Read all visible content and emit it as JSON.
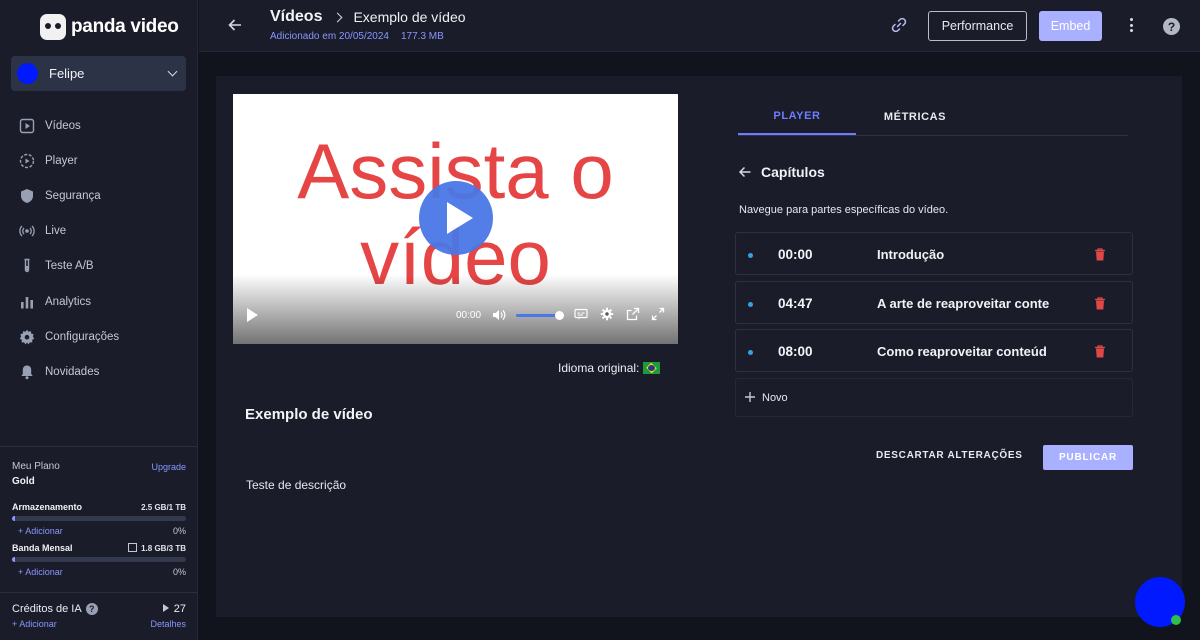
{
  "brand": {
    "name": "panda video"
  },
  "account": {
    "name": "Felipe",
    "avatar_color": "#0019ff"
  },
  "sidebar": {
    "items": [
      {
        "label": "Vídeos",
        "icon": "video-icon"
      },
      {
        "label": "Player",
        "icon": "player-icon"
      },
      {
        "label": "Segurança",
        "icon": "shield-icon"
      },
      {
        "label": "Live",
        "icon": "broadcast-icon"
      },
      {
        "label": "Teste A/B",
        "icon": "test-tube-icon"
      },
      {
        "label": "Analytics",
        "icon": "bar-chart-icon"
      },
      {
        "label": "Configurações",
        "icon": "gear-icon"
      },
      {
        "label": "Novidades",
        "icon": "bell-icon"
      }
    ]
  },
  "plan": {
    "label": "Meu Plano",
    "name": "Gold",
    "upgrade": "Upgrade",
    "storage": {
      "label": "Armazenamento",
      "value": "2.5 GB/1 TB",
      "add": "+ Adicionar",
      "percent": "0%",
      "fill": 0.0025
    },
    "bandwidth": {
      "label": "Banda Mensal",
      "value": "1.8 GB/3 TB",
      "add": "+ Adicionar",
      "percent": "0%",
      "fill": 0.0006
    },
    "credits": {
      "label": "Créditos de IA",
      "count": "27",
      "add": "+ Adicionar",
      "details": "Detalhes"
    }
  },
  "header": {
    "breadcrumb_root": "Vídeos",
    "title": "Exemplo de vídeo",
    "added": "Adicionado em 20/05/2024",
    "size": "177.3 MB",
    "performance_label": "Performance",
    "embed_label": "Embed"
  },
  "player": {
    "overlay_text_line1": "Assista o",
    "overlay_text_line2": "vídeo",
    "time": "00:00",
    "volume": 1.0,
    "language_label": "Idioma original:"
  },
  "video": {
    "title": "Exemplo de vídeo",
    "description": "Teste de descrição"
  },
  "tabs": [
    {
      "label": "PLAYER",
      "active": true
    },
    {
      "label": "MÉTRICAS",
      "active": false
    }
  ],
  "chapters": {
    "title": "Capítulos",
    "description": "Navegue para partes específicas do vídeo.",
    "items": [
      {
        "time": "00:00",
        "name": "Introdução"
      },
      {
        "time": "04:47",
        "name": "A arte de reaproveitar conte"
      },
      {
        "time": "08:00",
        "name": "Como reaproveitar  conteúd"
      }
    ],
    "new_label": "Novo",
    "discard_label": "DESCARTAR ALTERAÇÕES",
    "publish_label": "PUBLICAR"
  },
  "colors": {
    "accent": "#8a95ff",
    "tab_active": "#6f7cff",
    "trash": "#e04848",
    "chapter_dot": "#3b9fe8"
  }
}
